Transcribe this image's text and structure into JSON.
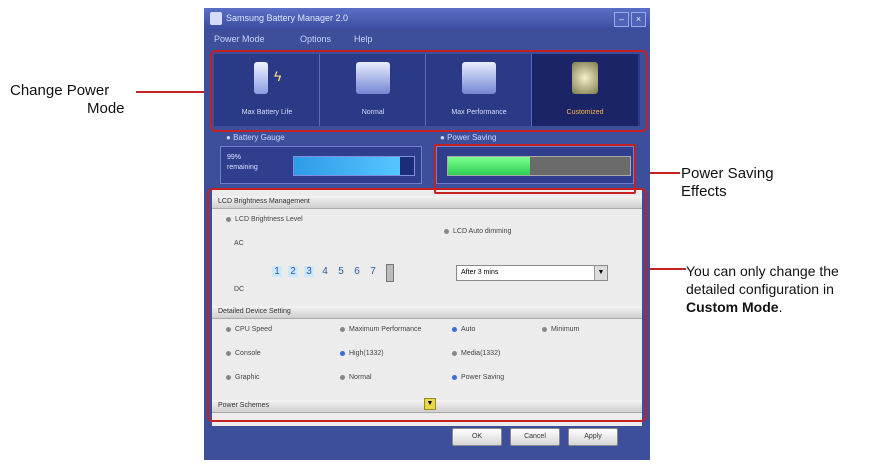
{
  "annotations": {
    "change_power_mode": [
      "Change Power",
      "Mode"
    ],
    "power_saving_effects": [
      "Power Saving",
      "Effects"
    ],
    "custom_mode_note": [
      "You can only change the",
      "detailed configuration in"
    ],
    "custom_mode_bold": "Custom Mode",
    "custom_mode_end": "."
  },
  "window": {
    "title": "Samsung Battery Manager 2.0",
    "menu": [
      "Power Mode",
      "Options",
      "Help"
    ]
  },
  "modes": [
    {
      "label": "Max Battery Life",
      "icon": "battery-icon",
      "active": false
    },
    {
      "label": "Normal",
      "icon": "laptop-icon",
      "active": false
    },
    {
      "label": "Max Performance",
      "icon": "laptop-performance-icon",
      "active": false
    },
    {
      "label": "Customized",
      "icon": "custom-settings-icon",
      "active": true
    }
  ],
  "battery_gauge": {
    "title": "Battery Gauge",
    "percent_text": "99%",
    "status_text": "remaining",
    "level": 0.88
  },
  "power_saving": {
    "title": "Power Saving",
    "level": 0.45
  },
  "lcd": {
    "section_title": "LCD Brightness Management",
    "level_label": "LCD Brightness Level",
    "ac_label": "AC",
    "dc_label": "DC",
    "levels": [
      "1",
      "2",
      "3",
      "4",
      "5",
      "6",
      "7"
    ],
    "auto_dimming_label": "LCD Auto dimming",
    "auto_dimming_value": "After 3 mins"
  },
  "device": {
    "section_title": "Detailed Device Setting",
    "rows": [
      {
        "name": "CPU Speed",
        "options": [
          "Maximum Performance",
          "Auto",
          "Minimum"
        ],
        "selected": 1
      },
      {
        "name": "Console",
        "options": [
          "High(1332)",
          "Media(1332)"
        ],
        "selected": 0
      },
      {
        "name": "Graphic",
        "options": [
          "Normal",
          "Power Saving"
        ],
        "selected": 1
      }
    ]
  },
  "power_schemes_label": "Power Schemes",
  "buttons": {
    "ok": "OK",
    "cancel": "Cancel",
    "apply": "Apply"
  },
  "colors": {
    "highlight": "#c42222",
    "window": "#3d4f9a",
    "battery_fill": "#2e9be8",
    "saving_fill": "#2fcf52"
  }
}
